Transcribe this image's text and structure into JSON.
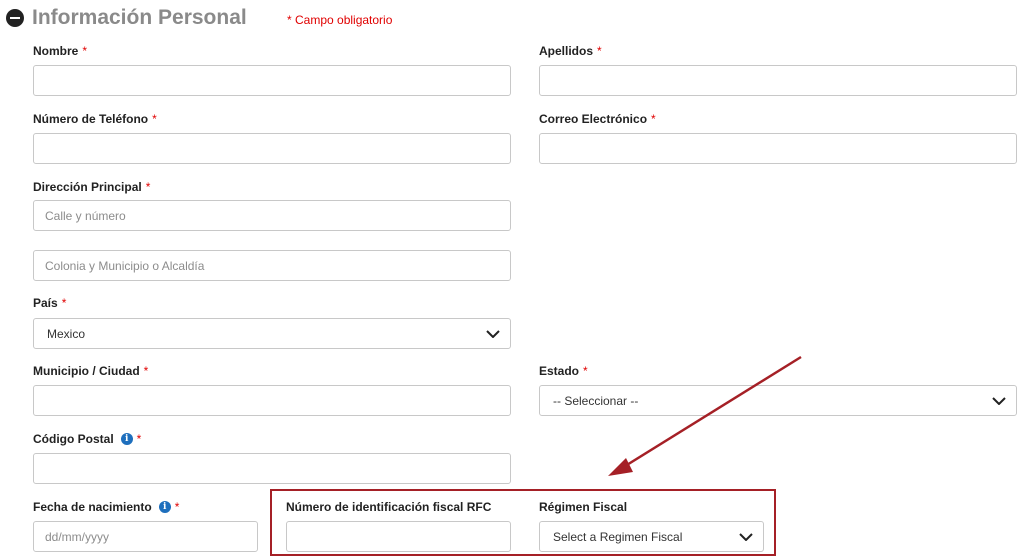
{
  "section": {
    "title": "Información Personal",
    "required_note": "* Campo obligatorio"
  },
  "required_mark": "*",
  "info_glyph": "i",
  "fields": {
    "nombre": {
      "label": "Nombre",
      "value": "",
      "placeholder": ""
    },
    "apellidos": {
      "label": "Apellidos",
      "value": "",
      "placeholder": ""
    },
    "telefono": {
      "label": "Número de Teléfono",
      "value": "",
      "placeholder": ""
    },
    "correo": {
      "label": "Correo Electrónico",
      "value": "",
      "placeholder": ""
    },
    "direccion": {
      "label": "Dirección Principal",
      "line1_placeholder": "Calle y número",
      "line2_placeholder": "Colonia y Municipio o Alcaldía"
    },
    "pais": {
      "label": "País",
      "selected": "Mexico"
    },
    "municipio": {
      "label": "Municipio / Ciudad",
      "value": "",
      "placeholder": ""
    },
    "estado": {
      "label": "Estado",
      "selected": "-- Seleccionar --"
    },
    "codigo_postal": {
      "label": "Código Postal",
      "value": "",
      "placeholder": ""
    },
    "fecha_nacimiento": {
      "label": "Fecha de nacimiento",
      "placeholder": "dd/mm/yyyy"
    },
    "rfc": {
      "label": "Número de identificación fiscal RFC",
      "value": "",
      "placeholder": ""
    },
    "regimen_fiscal": {
      "label": "Régimen Fiscal",
      "selected": "Select a Regimen Fiscal"
    }
  },
  "colors": {
    "required": "#e00000",
    "annotation": "#a52026",
    "info": "#1e6fbd",
    "title": "#8a8a8a"
  },
  "icons": {
    "collapse": "minus-circle-icon",
    "info": "info-icon",
    "dropdown": "chevron-down-icon",
    "annotation": "arrow-annotation"
  }
}
